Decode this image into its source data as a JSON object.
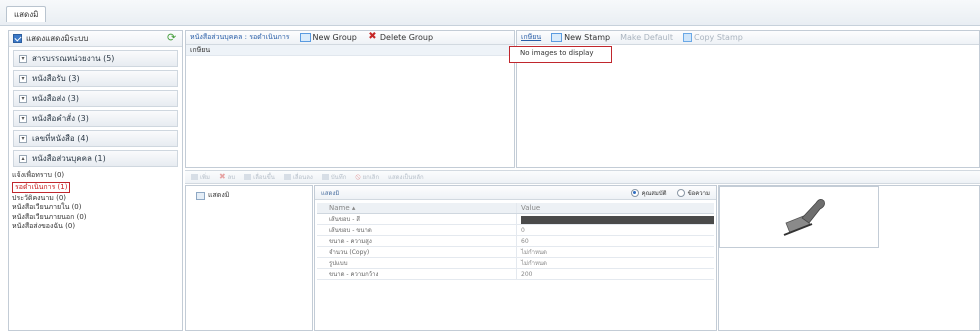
{
  "top_tab": "แสดงมิ",
  "sidebar": {
    "title": "แสดงแสดงมิระบบ",
    "groups": [
      {
        "label": "สารบรรณหน่วยงาน (5)",
        "toggle": "▾"
      },
      {
        "label": "หนังสือรับ (3)",
        "toggle": "▾"
      },
      {
        "label": "หนังสือส่ง (3)",
        "toggle": "▾"
      },
      {
        "label": "หนังสือคำสั่ง (3)",
        "toggle": "▾"
      },
      {
        "label": "เลขที่หนังสือ (4)",
        "toggle": "▾"
      },
      {
        "label": "หนังสือส่วนบุคคล (1)",
        "toggle": "▴"
      }
    ],
    "subitems": [
      "แจ้งเพื่อทราบ (0)",
      "รอดำเนินการ (1)",
      "ประวัติคงนาม (0)",
      "หนังสือเวียนภายใน (0)",
      "หนังสือเวียนภายนอก (0)",
      "หนังสือส่งของฉัน (0)"
    ]
  },
  "middle_top": {
    "breadcrumb": "หนังสือส่วนบุคคล : รอดำเนินการ",
    "new_group": "New Group",
    "delete_group": "Delete Group",
    "row": "เกษียน"
  },
  "right_top": {
    "active_tab": "เกษียน",
    "new_stamp": "New Stamp",
    "make_default": "Make Default",
    "copy_stamp": "Copy Stamp",
    "no_images": "No images to display"
  },
  "bottom_toolbar": [
    "เพิ่ม",
    "ลบ",
    "เลื่อนขึ้น",
    "เลื่อนลง",
    "บันทึก",
    "ยกเลิก",
    "แสดงเป็นหลัก"
  ],
  "tree": {
    "item": "แสดงมิ"
  },
  "property_grid": {
    "title": "แสดงมิ",
    "radio_1": "คุณสมบัติ",
    "radio_2": "ข้อความ",
    "col_name": "Name ▴",
    "col_value": "Value",
    "rows": [
      {
        "name": "เส้นขอบ - สี",
        "value": ""
      },
      {
        "name": "เส้นขอบ - ขนาด",
        "value": "0"
      },
      {
        "name": "ขนาด - ความสูง",
        "value": "60"
      },
      {
        "name": "จำนวน (Copy)",
        "value": "ไม่กำหนด"
      },
      {
        "name": "รูปแบบ",
        "value": "ไม่กำหนด"
      },
      {
        "name": "ขนาด - ความกว้าง",
        "value": "200"
      }
    ],
    "border_color": "#4a4a4a"
  },
  "colors": {
    "accent": "#2a5fa8",
    "highlight_border": "#c0272d"
  }
}
